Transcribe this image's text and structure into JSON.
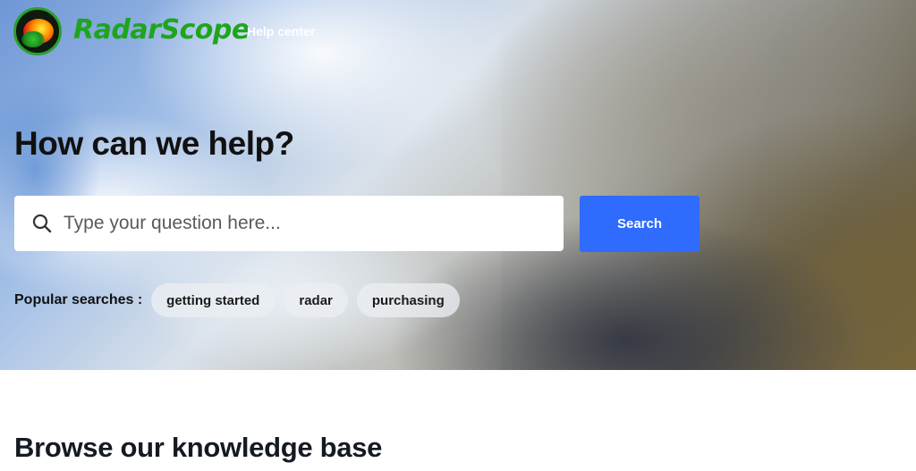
{
  "header": {
    "brand": "RadarScope",
    "help_center": "Help center"
  },
  "hero": {
    "title": "How can we help?",
    "search": {
      "placeholder": "Type your question here...",
      "button_label": "Search"
    },
    "popular": {
      "label": "Popular searches :",
      "chips": [
        "getting started",
        "radar",
        "purchasing"
      ]
    }
  },
  "main": {
    "section_title": "Browse our knowledge base"
  },
  "colors": {
    "brand_green": "#1ea51e",
    "search_button": "#2f6bfd"
  },
  "icons": {
    "logo": "radarscope-logo-icon",
    "search": "search-icon"
  }
}
